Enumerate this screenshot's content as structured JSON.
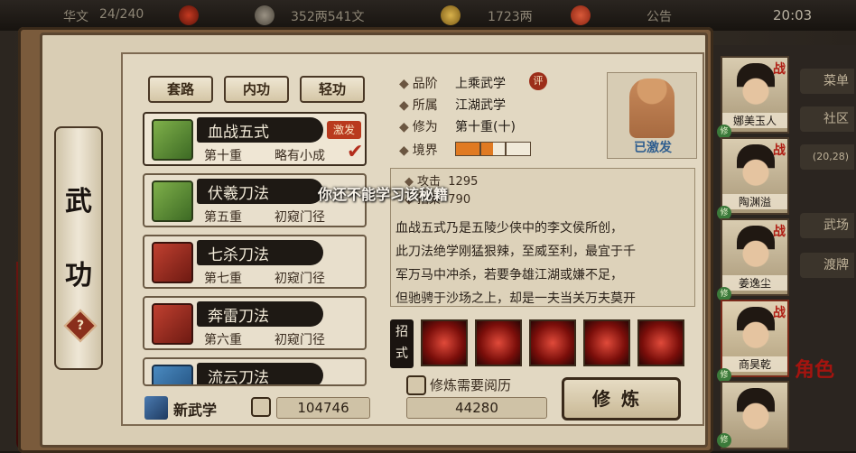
{
  "topbar": {
    "left_label": "华文",
    "left_count": "24/240",
    "money": "352两541文",
    "gold": "1723两",
    "notice": "公告",
    "time": "20:03"
  },
  "side_scroll": {
    "title_chars": [
      "武",
      "功"
    ],
    "help_icon": "?"
  },
  "tabs": [
    "套路",
    "内功",
    "轻功"
  ],
  "skills": [
    {
      "name": "血战五式",
      "level": "第十重",
      "rank": "略有小成",
      "badge": "激发",
      "checked": true,
      "book_color": "green"
    },
    {
      "name": "伏羲刀法",
      "level": "第五重",
      "rank": "初窥门径",
      "badge": "",
      "checked": false,
      "book_color": "green"
    },
    {
      "name": "七杀刀法",
      "level": "第七重",
      "rank": "初窥门径",
      "badge": "",
      "checked": false,
      "book_color": "red"
    },
    {
      "name": "奔雷刀法",
      "level": "第六重",
      "rank": "初窥门径",
      "badge": "",
      "checked": false,
      "book_color": "red"
    },
    {
      "name": "流云刀法",
      "level": "",
      "rank": "",
      "badge": "",
      "checked": false,
      "book_color": "blue"
    }
  ],
  "bottom_left": {
    "new_skill": "新武学",
    "points": "104746"
  },
  "detail": {
    "grade_label": "品阶",
    "grade_value": "上乘武学",
    "grade_icon": "评",
    "school_label": "所属",
    "school_value": "江湖武学",
    "cultivation_label": "修为",
    "cultivation_value": "第十重(十)",
    "realm_label": "境界",
    "realm_segments_filled": 1.5,
    "realm_segments_total": 3,
    "portrait_status": "已激发",
    "stat_attack_label": "攻击",
    "stat_attack_value": "1295",
    "stat_parry_label": "招架",
    "stat_parry_value": "790",
    "toast": "你还不能学习该秘籍",
    "desc_lines": [
      "血战五式乃是五陵少侠中的李文侯所创，",
      "此刀法绝学刚猛狠辣，至威至利，最宜于千",
      "军万马中冲杀，若要争雄江湖或嫌不足，",
      "但驰骋于沙场之上，却是一夫当关万夫莫开"
    ],
    "moves_label": "招式",
    "move_count": 5,
    "practice_hint": "修炼需要阅历",
    "practice_cost": "44280",
    "practice_button": "修炼"
  },
  "sidebar": {
    "tabs": [
      "菜单",
      "社区",
      "(20,28)",
      "武场",
      "渡牌"
    ],
    "heroes": [
      {
        "name": "娜美玉人",
        "tag": "战"
      },
      {
        "name": "陶渊溢",
        "tag": "战"
      },
      {
        "name": "姜逸尘",
        "tag": "战"
      },
      {
        "name": "商昊乾",
        "tag": "战"
      },
      {
        "name": "",
        "tag": ""
      }
    ],
    "xiu": "修",
    "role_button": "角色"
  },
  "colors": {
    "accent_red": "#b93a1e",
    "paper": "#d9cdb4",
    "ink": "#1e1914"
  }
}
